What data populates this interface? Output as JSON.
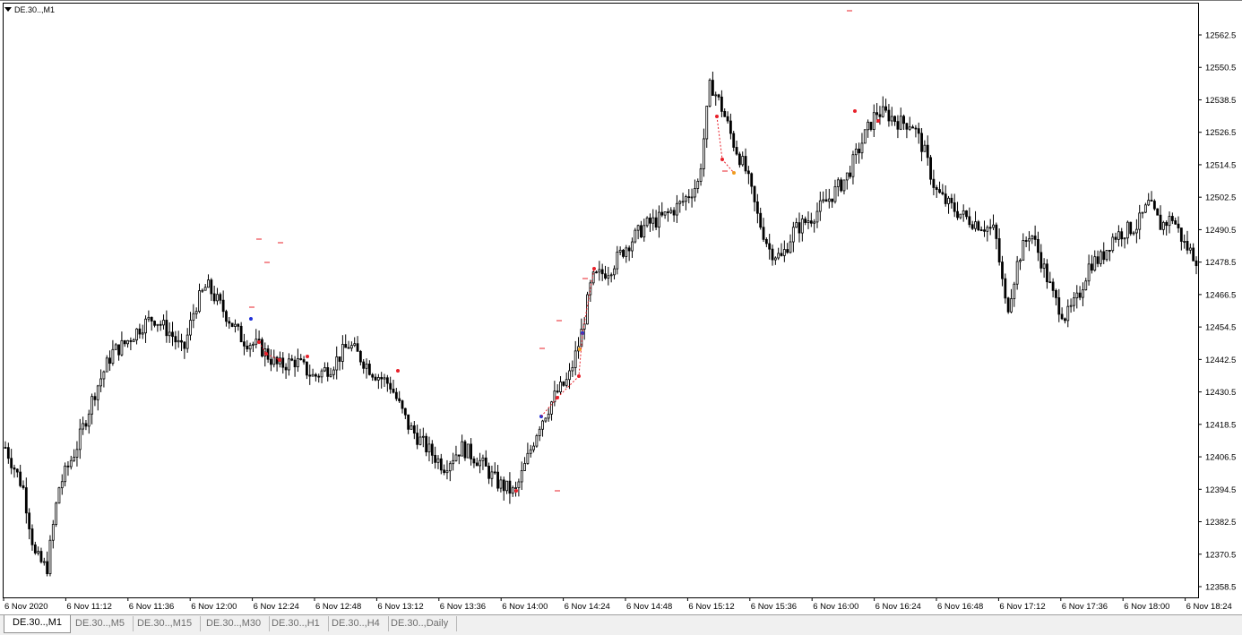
{
  "chart": {
    "title": "DE.30..,M1",
    "price_labels": [
      "12562.5",
      "12550.5",
      "12538.5",
      "12526.5",
      "12514.5",
      "12502.5",
      "12490.5",
      "12478.5",
      "12466.5",
      "12454.5",
      "12442.5",
      "12430.5",
      "12418.5",
      "12406.5",
      "12394.5",
      "12382.5",
      "12370.5",
      "12358.5"
    ],
    "time_labels": [
      "6 Nov 2020",
      "6 Nov 11:12",
      "6 Nov 11:36",
      "6 Nov 12:00",
      "6 Nov 12:24",
      "6 Nov 12:48",
      "6 Nov 13:12",
      "6 Nov 13:36",
      "6 Nov 14:00",
      "6 Nov 14:24",
      "6 Nov 14:48",
      "6 Nov 15:12",
      "6 Nov 15:36",
      "6 Nov 16:00",
      "6 Nov 16:24",
      "6 Nov 16:48",
      "6 Nov 17:12",
      "6 Nov 17:36",
      "6 Nov 18:00",
      "6 Nov 18:24"
    ],
    "price_axis": {
      "min": 12358.5,
      "max": 12562.5
    },
    "price_path_anchors": [
      [
        0,
        12410
      ],
      [
        3,
        12395
      ],
      [
        5,
        12370
      ],
      [
        7,
        12365
      ],
      [
        9,
        12395
      ],
      [
        12,
        12410
      ],
      [
        15,
        12430
      ],
      [
        18,
        12445
      ],
      [
        20,
        12448
      ],
      [
        23,
        12455
      ],
      [
        25,
        12458
      ],
      [
        28,
        12452
      ],
      [
        30,
        12445
      ],
      [
        32,
        12462
      ],
      [
        34,
        12470
      ],
      [
        37,
        12460
      ],
      [
        40,
        12450
      ],
      [
        43,
        12447
      ],
      [
        46,
        12440
      ],
      [
        49,
        12442
      ],
      [
        52,
        12436
      ],
      [
        55,
        12440
      ],
      [
        58,
        12448
      ],
      [
        60,
        12443
      ],
      [
        62,
        12438
      ],
      [
        65,
        12433
      ],
      [
        68,
        12418
      ],
      [
        71,
        12410
      ],
      [
        74,
        12403
      ],
      [
        77,
        12410
      ],
      [
        80,
        12405
      ],
      [
        83,
        12397
      ],
      [
        86,
        12393
      ],
      [
        88,
        12405
      ],
      [
        90,
        12418
      ],
      [
        93,
        12430
      ],
      [
        95,
        12435
      ],
      [
        97,
        12450
      ],
      [
        99,
        12472
      ],
      [
        102,
        12476
      ],
      [
        105,
        12485
      ],
      [
        108,
        12492
      ],
      [
        111,
        12495
      ],
      [
        114,
        12500
      ],
      [
        117,
        12508
      ],
      [
        119,
        12545
      ],
      [
        121,
        12535
      ],
      [
        123,
        12522
      ],
      [
        125,
        12512
      ],
      [
        127,
        12495
      ],
      [
        129,
        12483
      ],
      [
        131,
        12480
      ],
      [
        133,
        12490
      ],
      [
        136,
        12495
      ],
      [
        139,
        12502
      ],
      [
        142,
        12510
      ],
      [
        145,
        12525
      ],
      [
        147,
        12534
      ],
      [
        149,
        12533
      ],
      [
        151,
        12530
      ],
      [
        153,
        12530
      ],
      [
        155,
        12520
      ],
      [
        157,
        12505
      ],
      [
        159,
        12500
      ],
      [
        162,
        12495
      ],
      [
        165,
        12492
      ],
      [
        167,
        12490
      ],
      [
        169,
        12460
      ],
      [
        171,
        12480
      ],
      [
        173,
        12490
      ],
      [
        175,
        12478
      ],
      [
        177,
        12465
      ],
      [
        179,
        12458
      ],
      [
        181,
        12465
      ],
      [
        183,
        12478
      ],
      [
        185,
        12480
      ],
      [
        187,
        12488
      ],
      [
        189,
        12490
      ],
      [
        191,
        12492
      ],
      [
        193,
        12500
      ],
      [
        195,
        12492
      ],
      [
        197,
        12495
      ],
      [
        199,
        12485
      ],
      [
        201,
        12480
      ]
    ]
  },
  "tabs": [
    {
      "label": "DE.30..,M1",
      "active": true
    },
    {
      "label": "DE.30..,M5",
      "active": false
    },
    {
      "label": "DE.30..,M15",
      "active": false
    },
    {
      "label": "DE.30..,M30",
      "active": false
    },
    {
      "label": "DE.30..,H1",
      "active": false
    },
    {
      "label": "DE.30..,H4",
      "active": false
    },
    {
      "label": "DE.30..,Daily",
      "active": false
    }
  ],
  "colors": {
    "candle": "#000000",
    "marker_red": "#e8202a",
    "marker_blue": "#2030d8",
    "marker_orange": "#f0a020",
    "axis": "#000000"
  }
}
